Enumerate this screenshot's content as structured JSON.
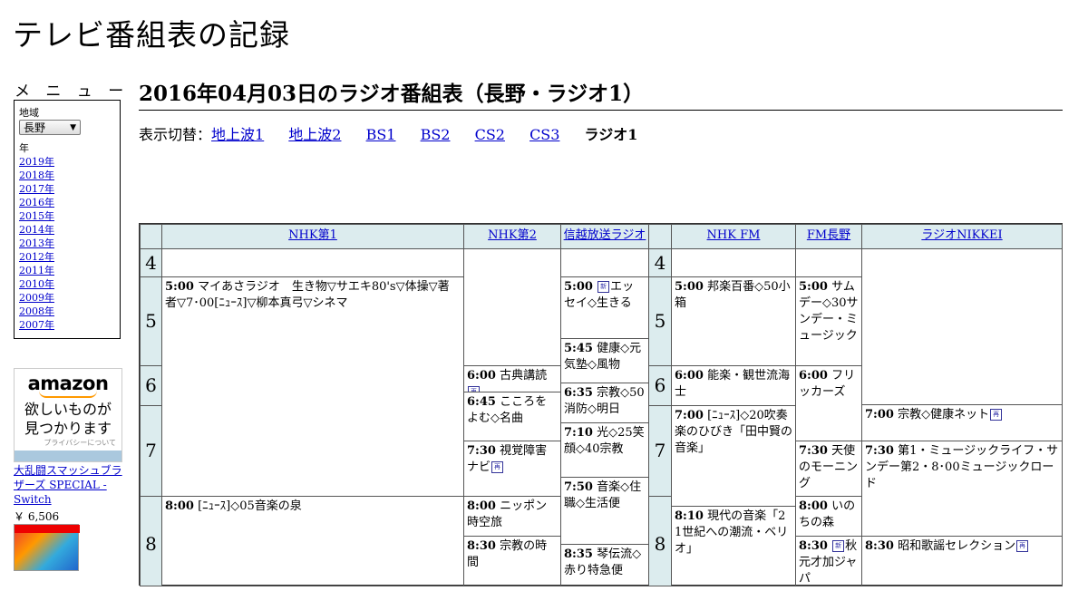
{
  "site": {
    "title": "テレビ番組表の記録"
  },
  "menu": {
    "title": "メ ニ ュ ー",
    "region_label": "地域",
    "region_value": "長野",
    "year_label": "年",
    "years": [
      "2019年",
      "2018年",
      "2017年",
      "2016年",
      "2015年",
      "2014年",
      "2013年",
      "2012年",
      "2011年",
      "2010年",
      "2009年",
      "2008年",
      "2007年"
    ]
  },
  "ad": {
    "brand": "amazon",
    "tagline1": "欲しいものが",
    "tagline2": "見つかります",
    "privacy": "プライバシーについて",
    "product": "大乱闘スマッシュブラザーズ SPECIAL - Switch",
    "price": "￥ 6,506"
  },
  "page": {
    "title": "2016年04月03日のラジオ番組表（長野・ラジオ1）"
  },
  "switcher": {
    "label": "表示切替：",
    "links": [
      "地上波1",
      "地上波2",
      "BS1",
      "BS2",
      "CS2",
      "CS3"
    ],
    "current": "ラジオ1"
  },
  "channels": [
    "NHK第1",
    "NHK第2",
    "信越放送ラジオ",
    "NHK FM",
    "FM長野",
    "ラジオNIKKEI"
  ],
  "hours": [
    "4",
    "5",
    "6",
    "7",
    "8"
  ],
  "programs": {
    "nhk1_0500": {
      "time": "5:00",
      "title": "マイあさラジオ　生き物▽サエキ80's▽体操▽著者▽7･00[ﾆｭｰｽ]▽柳本真弓▽シネマ"
    },
    "nhk1_0800": {
      "time": "8:00",
      "title": "[ﾆｭｰｽ]◇05音楽の泉"
    },
    "nhk2_0600": {
      "time": "6:00",
      "title": "古典講読"
    },
    "nhk2_0645": {
      "time": "6:45",
      "title": "こころをよむ◇名曲"
    },
    "nhk2_0730": {
      "time": "7:30",
      "title": "視覚障害ナビ"
    },
    "nhk2_0800": {
      "time": "8:00",
      "title": "ニッポン時空旅"
    },
    "nhk2_0830": {
      "time": "8:30",
      "title": "宗教の時間"
    },
    "sbc_0500": {
      "time": "5:00",
      "title": "エッセイ◇生きる"
    },
    "sbc_0545": {
      "time": "5:45",
      "title": "健康◇元気塾◇風物"
    },
    "sbc_0635": {
      "time": "6:35",
      "title": "宗教◇50消防◇明日"
    },
    "sbc_0710": {
      "time": "7:10",
      "title": "光◇25笑顔◇40宗教"
    },
    "sbc_0750": {
      "time": "7:50",
      "title": "音楽◇住職◇生活便"
    },
    "sbc_0835": {
      "time": "8:35",
      "title": "琴伝流◇赤り特急便"
    },
    "fm_0500": {
      "time": "5:00",
      "title": "邦楽百番◇50小箱"
    },
    "fm_0600": {
      "time": "6:00",
      "title": "能楽・観世流海士"
    },
    "fm_0700": {
      "time": "7:00",
      "title": "[ﾆｭｰｽ]◇20吹奏楽のひびき「田中賢の音楽」"
    },
    "fm_0810": {
      "time": "8:10",
      "title": "現代の音楽「21世紀への潮流・ベリオ」"
    },
    "fmn_0500": {
      "time": "5:00",
      "title": "サムデー◇30サンデー・ミュージック"
    },
    "fmn_0600": {
      "time": "6:00",
      "title": "フリッカーズ"
    },
    "fmn_0730": {
      "time": "7:30",
      "title": "天使のモーニング"
    },
    "fmn_0800": {
      "time": "8:00",
      "title": "いのちの森"
    },
    "fmn_0830": {
      "time": "8:30",
      "title": "秋元才加ジャパ"
    },
    "nikkei_0700": {
      "time": "7:00",
      "title": "宗教◇健康ネット"
    },
    "nikkei_0730": {
      "time": "7:30",
      "title": "第1・ミュージックライフ・サンデー第2・8･00ミュージックロード"
    },
    "nikkei_0830": {
      "time": "8:30",
      "title": "昭和歌謡セレクション"
    }
  },
  "icons": {
    "new": "新",
    "rebroadcast": "再"
  }
}
